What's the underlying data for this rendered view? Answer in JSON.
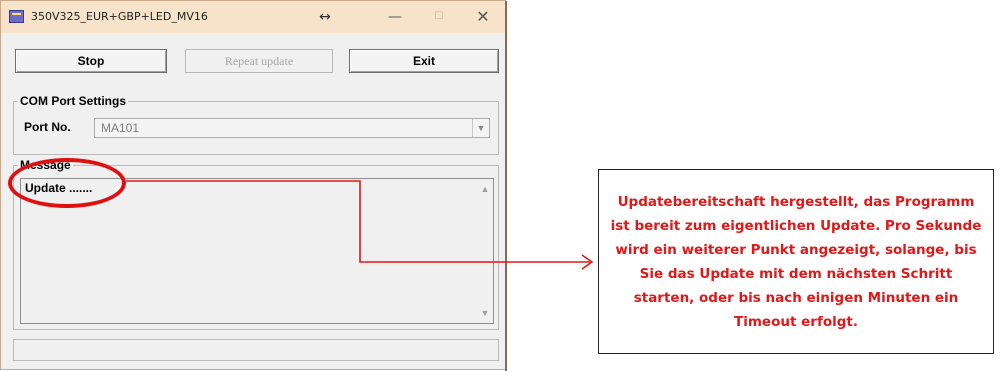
{
  "window": {
    "title": "350V325_EUR+GBP+LED_MV16",
    "resize_glyph": "↔",
    "min_glyph": "—",
    "max_glyph": "☐",
    "close_glyph": "✕"
  },
  "toolbar": {
    "stop_label": "Stop",
    "repeat_label": "Repeat update",
    "exit_label": "Exit"
  },
  "com_settings": {
    "group_label": "COM Port Settings",
    "port_label": "Port No.",
    "port_value": "MA101"
  },
  "message": {
    "group_label": "Message",
    "text": "Update ......."
  },
  "annotation": {
    "text": "Updatebereitschaft hergestellt, das Programm ist bereit zum eigentlichen Update. Pro Sekunde wird ein weiterer Punkt angezeigt, solange, bis Sie das Update mit dem nächsten Schritt starten, oder bis nach einigen Minuten ein Timeout erfolgt.",
    "color": "#e01818"
  },
  "colors": {
    "titlebar": "#f6e3c9",
    "window_bg": "#f0f0f0",
    "disabled_text": "#a8a8a8"
  },
  "icons": {
    "app": "app-icon",
    "dropdown": "chevron-down-icon",
    "scroll_up": "scroll-up-icon",
    "scroll_down": "scroll-down-icon"
  }
}
